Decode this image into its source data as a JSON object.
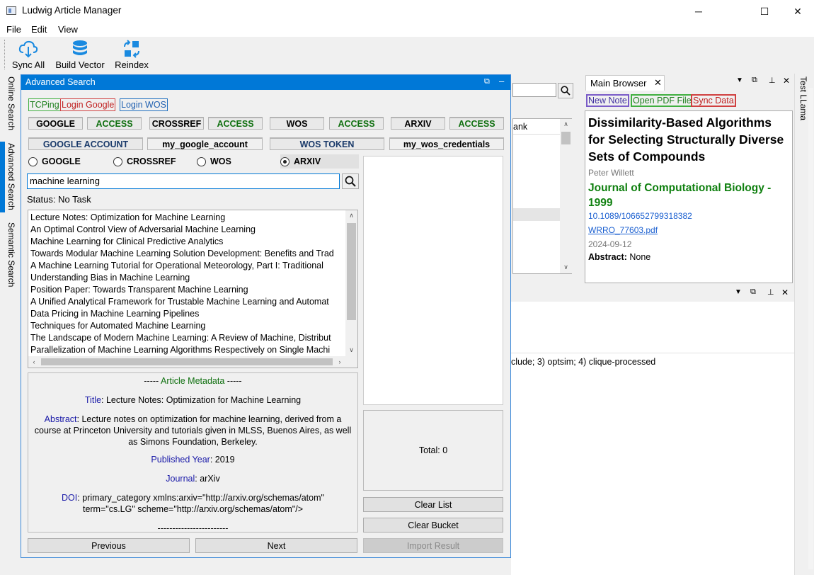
{
  "window": {
    "title": "Ludwig Article Manager",
    "minimize_glyph": "─",
    "maximize_glyph": "☐",
    "close_glyph": "✕"
  },
  "menu": [
    "File",
    "Edit",
    "View"
  ],
  "toolbar": {
    "sync_all": "Sync All",
    "build_vector": "Build Vector",
    "reindex": "Reindex"
  },
  "left_tabs": [
    "Online Search",
    "Advanced Search",
    "Semantic Search"
  ],
  "right_tab": "Test LLama",
  "advanced_search": {
    "title": "Advanced Search",
    "pin_glyph": "⊣",
    "min_glyph": "–",
    "tcping": "TCPing",
    "login_google": "Login Google",
    "login_wos": "Login WOS",
    "access_row": [
      {
        "name": "GOOGLE",
        "access": "ACCESS"
      },
      {
        "name": "CROSSREF",
        "access": "ACCESS"
      },
      {
        "name": "WOS",
        "access": "ACCESS"
      },
      {
        "name": "ARXIV",
        "access": "ACCESS"
      }
    ],
    "google_account_label": "GOOGLE ACCOUNT",
    "google_account_value": "my_google_account",
    "wos_token_label": "WOS TOKEN",
    "wos_token_value": "my_wos_credentials",
    "sources": [
      "GOOGLE",
      "CROSSREF",
      "WOS",
      "ARXIV"
    ],
    "selected_source": "ARXIV",
    "query": "machine learning",
    "status": "Status: No Task",
    "results": [
      "Lecture Notes: Optimization for Machine Learning",
      "An Optimal Control View of Adversarial Machine Learning",
      "Machine Learning for Clinical Predictive Analytics",
      "Towards Modular Machine Learning Solution Development: Benefits and Trad",
      "A Machine Learning Tutorial for Operational Meteorology, Part I: Traditional",
      "Understanding Bias in Machine Learning",
      "Position Paper: Towards Transparent Machine Learning",
      "A Unified Analytical Framework for Trustable Machine Learning and Automat",
      "Data Pricing in Machine Learning Pipelines",
      "Techniques for Automated Machine Learning",
      "The Landscape of Modern Machine Learning: A Review of Machine, Distribut",
      "Parallelization of Machine Learning Algorithms Respectively on Single Machi"
    ],
    "metadata": {
      "header": "----- Article Metadata -----",
      "header_prefix": "----- ",
      "header_text": "Article Metadata",
      "header_suffix": " -----",
      "title_key": "Title",
      "title_value": "Lecture Notes: Optimization for Machine Learning",
      "abstract_key": "Abstract",
      "abstract_value_1": "Lecture notes on optimization for machine learning, derived from a",
      "abstract_value_2": "course at Princeton University and tutorials given in MLSS, Buenos Aires, as well",
      "abstract_value_3": "as Simons Foundation, Berkeley.",
      "year_key": "Published Year",
      "year_value": "2019",
      "journal_key": "Journal",
      "journal_value": "arXiv",
      "doi_key": "DOI",
      "doi_value_1": "primary_category xmlns:arxiv=\"http://arxiv.org/schemas/atom\"",
      "doi_value_2": "term=\"cs.LG\" scheme=\"http://arxiv.org/schemas/atom\"/>",
      "footer": "------------------------"
    },
    "total": "Total: 0",
    "clear_list": "Clear List",
    "clear_bucket": "Clear Bucket",
    "import_result": "Import Result",
    "previous": "Previous",
    "next": "Next"
  },
  "background": {
    "column_header_fragment": "ank",
    "log_fragment": "clude; 3) optsim; 4) clique-processed"
  },
  "main_browser": {
    "tab_label": "Main Browser",
    "new_note": "New Note",
    "open_pdf": "Open PDF File",
    "sync_data": "Sync Data",
    "title": "Dissimilarity-Based Algorithms for Selecting Structurally Diverse Sets of Compounds",
    "author": "Peter Willett",
    "journal": "Journal of Computational Biology - 1999",
    "doi": "10.1089/106652799318382",
    "pdf": "WRRO_77603.pdf",
    "date": "2024-09-12",
    "abstract_label": "Abstract:",
    "abstract_value": " None"
  },
  "colors": {
    "accent": "#0078d7",
    "green": "#107010",
    "link_blue": "#1a5fd0",
    "tcping_border": "#40b040",
    "google_border": "#d04040",
    "wos_border": "#2070c0",
    "new_note_border": "#7a5cc8"
  }
}
